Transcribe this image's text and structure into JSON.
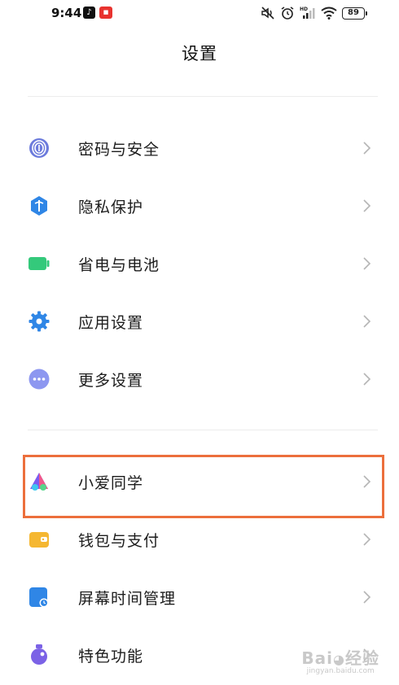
{
  "status_bar": {
    "time": "9:44",
    "battery": "89",
    "icons": [
      "tiktok-icon",
      "app-icon",
      "mute-icon",
      "alarm-icon",
      "signal-icon",
      "wifi-icon",
      "battery-icon"
    ]
  },
  "header": {
    "title": "设置"
  },
  "groups": [
    {
      "items": [
        {
          "label": "密码与安全",
          "icon": "fingerprint-icon",
          "color": "#6c7bdc"
        },
        {
          "label": "隐私保护",
          "icon": "privacy-shield-icon",
          "color": "#2f86e6"
        },
        {
          "label": "省电与电池",
          "icon": "battery-icon",
          "color": "#34c97b"
        },
        {
          "label": "应用设置",
          "icon": "gear-icon",
          "color": "#2f86e6"
        },
        {
          "label": "更多设置",
          "icon": "more-dots-icon",
          "color": "#8d97f0"
        }
      ]
    },
    {
      "items": [
        {
          "label": "小爱同学",
          "icon": "xiaoai-icon",
          "color": "#7b5cf0",
          "highlighted": true
        },
        {
          "label": "钱包与支付",
          "icon": "wallet-icon",
          "color": "#f5b731"
        },
        {
          "label": "屏幕时间管理",
          "icon": "screen-time-icon",
          "color": "#2f86e6"
        },
        {
          "label": "特色功能",
          "icon": "special-features-icon",
          "color": "#7b62e6"
        }
      ]
    }
  ],
  "highlight_color": "#ec6f3c"
}
